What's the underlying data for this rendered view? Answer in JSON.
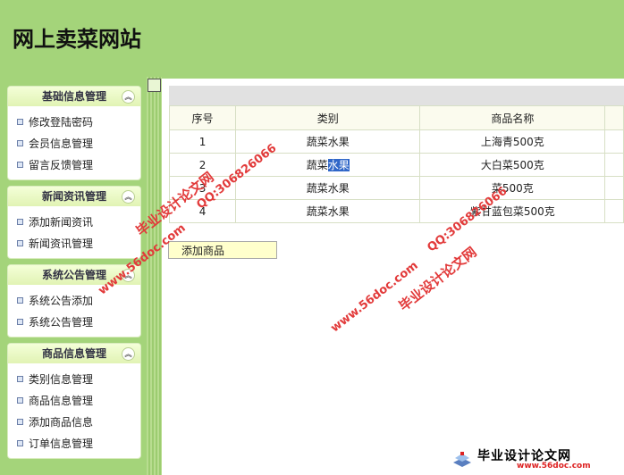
{
  "header": {
    "title": "网上卖菜网站"
  },
  "sidebar": {
    "panels": [
      {
        "title": "基础信息管理",
        "items": [
          "修改登陆密码",
          "会员信息管理",
          "留言反馈管理"
        ]
      },
      {
        "title": "新闻资讯管理",
        "items": [
          "添加新闻资讯",
          "新闻资讯管理"
        ]
      },
      {
        "title": "系统公告管理",
        "items": [
          "系统公告添加",
          "系统公告管理"
        ]
      },
      {
        "title": "商品信息管理",
        "items": [
          "类别信息管理",
          "商品信息管理",
          "添加商品信息",
          "订单信息管理"
        ]
      }
    ],
    "collapse_glyph": "︽"
  },
  "table": {
    "headers": [
      "序号",
      "类别",
      "商品名称"
    ],
    "rows": [
      {
        "no": "1",
        "category": "蔬菜水果",
        "name": "上海青500克"
      },
      {
        "no": "2",
        "category_plain": "蔬菜",
        "category_selected": "水果",
        "name": "大白菜500克"
      },
      {
        "no": "3",
        "category": "蔬菜水果",
        "name": "菜500克"
      },
      {
        "no": "4",
        "category": "蔬菜水果",
        "name": "紫甘蓝包菜500克"
      }
    ]
  },
  "buttons": {
    "add_product": "添加商品"
  },
  "watermarks": {
    "site_text": "毕业设计论文网",
    "qq": "QQ:306826066",
    "url": "www.56doc.com"
  },
  "footer_logo": {
    "name": "毕业设计论文网",
    "url": "www.56doc.com"
  },
  "colors": {
    "background": "#a4d47a",
    "panel_header": "#e1f3b4",
    "selection": "#3067c8",
    "watermark": "#e23a3a"
  }
}
